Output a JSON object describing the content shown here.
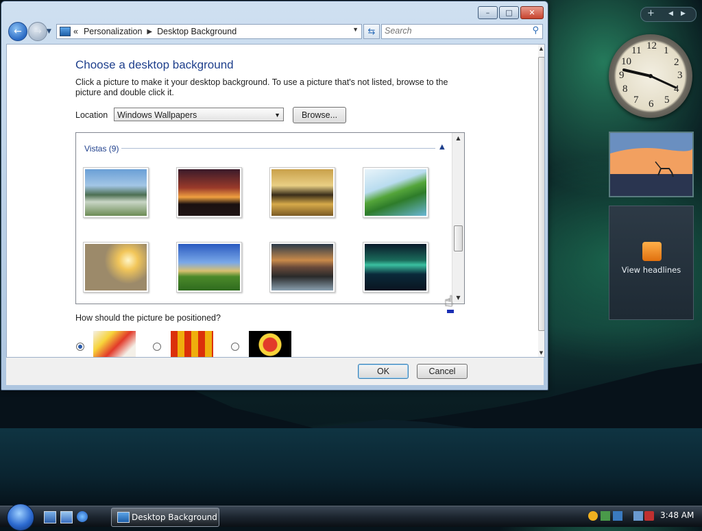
{
  "window": {
    "title_buttons": {
      "minimize": "minimize-icon",
      "maximize": "maximize-icon",
      "close": "close-icon"
    },
    "breadcrumb": [
      "Personalization",
      "Desktop Background"
    ],
    "breadcrumb_prefix": "«",
    "search_placeholder": "Search"
  },
  "content": {
    "title": "Choose a desktop background",
    "description": "Click a picture to make it your desktop background. To use a picture that's not listed, browse to the picture and double click it.",
    "location_label": "Location",
    "location_value": "Windows Wallpapers",
    "browse_label": "Browse...",
    "group_header": "Vistas (9)",
    "positioned_label": "How should the picture be positioned?",
    "selected_position": "fit",
    "thumbnails": [
      "mountain-lake",
      "sunset-ridge",
      "golden-coast",
      "green-leaf",
      "sun-field",
      "green-hills",
      "rock-reflection",
      "aurora"
    ]
  },
  "footer": {
    "ok_label": "OK",
    "cancel_label": "Cancel"
  },
  "sidebar": {
    "clock_numbers": [
      "12",
      "1",
      "2",
      "3",
      "4",
      "5",
      "6",
      "7",
      "8",
      "9",
      "10",
      "11"
    ],
    "feed_label": "View headlines"
  },
  "taskbar": {
    "task_label": "Desktop Background",
    "time": "3:48 AM"
  },
  "colors": {
    "accent": "#1e3f8c",
    "taskbar": "#1d2630"
  }
}
